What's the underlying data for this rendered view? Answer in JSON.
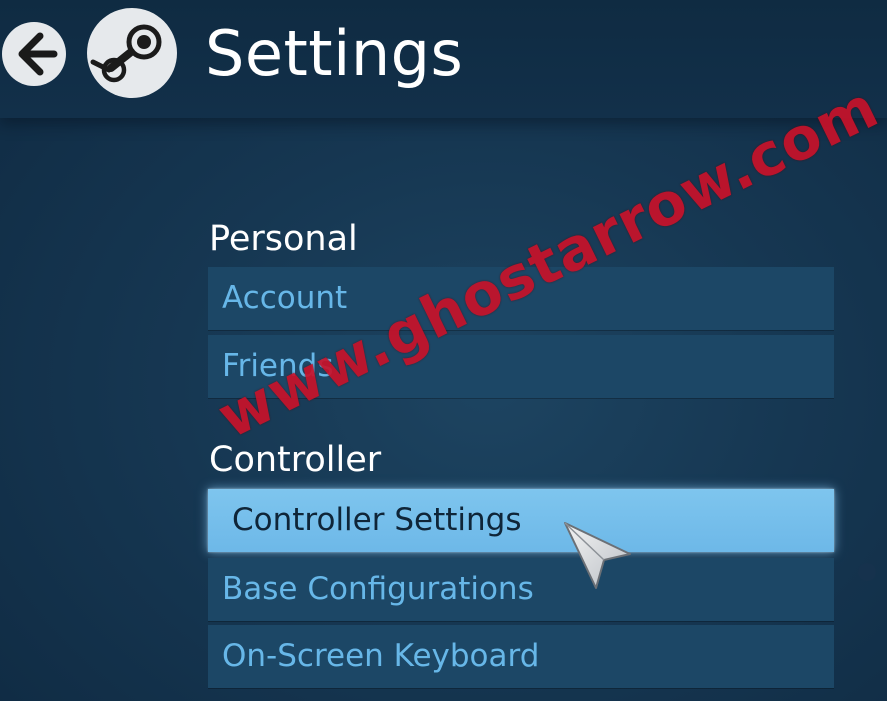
{
  "header": {
    "title": "Settings",
    "back_icon": "back-arrow-icon",
    "logo_icon": "steam-logo-icon"
  },
  "sections": [
    {
      "title": "Personal",
      "items": [
        {
          "label": "Account"
        },
        {
          "label": "Friends"
        }
      ]
    },
    {
      "title": "Controller",
      "items": [
        {
          "label": "Controller Settings",
          "selected": true
        },
        {
          "label": "Base Configurations"
        },
        {
          "label": "On-Screen Keyboard"
        }
      ]
    }
  ],
  "watermark": {
    "text": "www.ghostarrow.com"
  },
  "colors": {
    "background": "#163752",
    "item_background": "#1c4766",
    "item_text": "#67b7e8",
    "selected_background": "#74bdea",
    "selected_text": "#0f2538",
    "watermark": "#c8122a"
  }
}
